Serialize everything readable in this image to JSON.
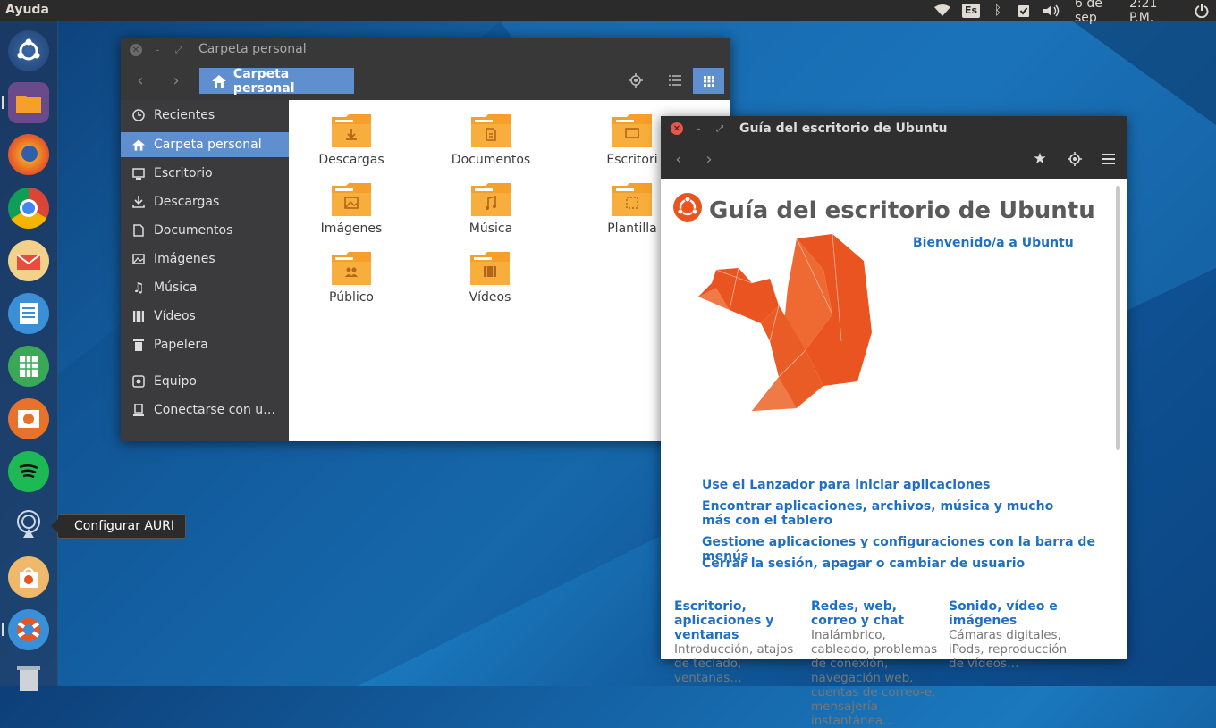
{
  "topbar": {
    "menu": "Ayuda",
    "keyboard_layout": "Es",
    "date": "6 de sep",
    "time": "2:21 P.M.",
    "icons": [
      "wifi-icon",
      "bluetooth-icon",
      "updates-icon",
      "volume-icon",
      "power-icon"
    ]
  },
  "launcher": {
    "items": [
      {
        "name": "dash-launcher"
      },
      {
        "name": "files-launcher"
      },
      {
        "name": "firefox-launcher"
      },
      {
        "name": "chrome-launcher"
      },
      {
        "name": "mail-launcher"
      },
      {
        "name": "writer-launcher"
      },
      {
        "name": "calc-launcher"
      },
      {
        "name": "impress-launcher"
      },
      {
        "name": "spotify-launcher"
      },
      {
        "name": "auri-launcher"
      },
      {
        "name": "software-launcher"
      },
      {
        "name": "help-launcher"
      },
      {
        "name": "trash-launcher"
      }
    ],
    "tooltip": "Configurar AURI"
  },
  "files_window": {
    "title": "Carpeta personal",
    "location": "Carpeta personal",
    "sidebar": [
      {
        "label": "Recientes",
        "icon": "clock-icon"
      },
      {
        "label": "Carpeta personal",
        "icon": "home-icon",
        "active": true
      },
      {
        "label": "Escritorio",
        "icon": "desktop-icon"
      },
      {
        "label": "Descargas",
        "icon": "download-icon"
      },
      {
        "label": "Documentos",
        "icon": "document-icon"
      },
      {
        "label": "Imágenes",
        "icon": "image-icon"
      },
      {
        "label": "Música",
        "icon": "music-icon"
      },
      {
        "label": "Vídeos",
        "icon": "video-icon"
      },
      {
        "label": "Papelera",
        "icon": "trash-icon"
      },
      {
        "label": "Equipo",
        "icon": "computer-icon"
      },
      {
        "label": "Conectarse con u…",
        "icon": "server-icon"
      }
    ],
    "folders": [
      {
        "label": "Descargas",
        "glyph": "⤓"
      },
      {
        "label": "Documentos",
        "glyph": "▤"
      },
      {
        "label": "Escritori",
        "glyph": "▭"
      },
      {
        "label": "Imágenes",
        "glyph": "▣"
      },
      {
        "label": "Música",
        "glyph": "♫"
      },
      {
        "label": "Plantilla",
        "glyph": "⬚"
      },
      {
        "label": "Público",
        "glyph": "👥"
      },
      {
        "label": "Vídeos",
        "glyph": "▦"
      }
    ]
  },
  "help_window": {
    "title": "Guía del escritorio de Ubuntu",
    "heading": "Guía del escritorio de Ubuntu",
    "welcome_link": "Bienvenido/a a Ubuntu",
    "links": [
      "Use el Lanzador para iniciar aplicaciones",
      "Encontrar aplicaciones, archivos, música y mucho más con el tablero",
      "Gestione aplicaciones y configuraciones con la barra de menús",
      "Cerrar la sesión, apagar o cambiar de usuario"
    ],
    "topics": [
      {
        "title": "Escritorio, aplicaciones y ventanas",
        "desc": "Introducción, atajos de teclado, ventanas…"
      },
      {
        "title": "Redes, web, correo y chat",
        "desc": "Inalámbrico, cableado, problemas de conexión, navegación web, cuentas de correo-e, mensajería instantánea…"
      },
      {
        "title": "Sonido, vídeo e imágenes",
        "desc": "Cámaras digitales, iPods, reproducción de vídeos…"
      }
    ]
  },
  "colors": {
    "accent_orange": "#e95420",
    "folder_orange": "#f6a02b",
    "link_blue": "#1f6fc4",
    "selection_blue": "#5f8fcf",
    "panel": "#2b2b2b",
    "titlebar": "#383838"
  }
}
